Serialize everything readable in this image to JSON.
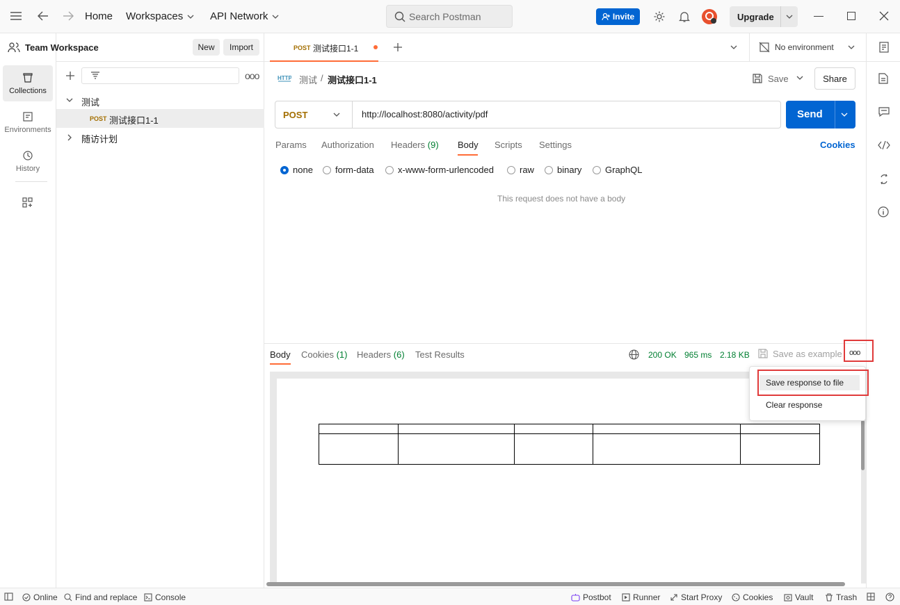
{
  "topbar": {
    "home": "Home",
    "workspaces": "Workspaces",
    "api_network": "API Network",
    "search_placeholder": "Search Postman",
    "invite": "Invite",
    "upgrade": "Upgrade"
  },
  "leftnav": {
    "collections": "Collections",
    "environments": "Environments",
    "history": "History"
  },
  "sidebar": {
    "workspace_name": "Team Workspace",
    "new_btn": "New",
    "import_btn": "Import",
    "tree": [
      {
        "label": "测试",
        "expanded": true
      },
      {
        "method": "POST",
        "label": "测试接口1-1",
        "selected": true
      },
      {
        "label": "随访计划",
        "expanded": false
      }
    ]
  },
  "tabs": {
    "open_tab_method": "POST",
    "open_tab_title": "测试接口1-1",
    "environment": "No environment"
  },
  "request": {
    "breadcrumb_parent": "测试",
    "breadcrumb_sep": "/",
    "breadcrumb_current": "测试接口1-1",
    "save": "Save",
    "share": "Share",
    "method": "POST",
    "url": "http://localhost:8080/activity/pdf",
    "send": "Send",
    "tabs": [
      "Params",
      "Authorization",
      "Headers",
      "Body",
      "Scripts",
      "Settings"
    ],
    "headers_count": "(9)",
    "active_tab": "Body",
    "cookies": "Cookies",
    "body_types": [
      "none",
      "form-data",
      "x-www-form-urlencoded",
      "raw",
      "binary",
      "GraphQL"
    ],
    "selected_body_type": "none",
    "empty_body_msg": "This request does not have a body"
  },
  "response": {
    "tabs": [
      "Body",
      "Cookies",
      "Headers",
      "Test Results"
    ],
    "cookies_count": "(1)",
    "headers_count": "(6)",
    "status": "200 OK",
    "time": "965 ms",
    "size": "2.18 KB",
    "save_example": "Save as example",
    "menu_items": [
      "Save response to file",
      "Clear response"
    ]
  },
  "statusbar": {
    "online": "Online",
    "find_replace": "Find and replace",
    "console": "Console",
    "postbot": "Postbot",
    "runner": "Runner",
    "start_proxy": "Start Proxy",
    "cookies": "Cookies",
    "vault": "Vault",
    "trash": "Trash"
  },
  "colors": {
    "accent_blue": "#0265d2",
    "method_post": "#a36e00",
    "status_green": "#007f31",
    "tab_active_underline": "#ff6c37",
    "highlight_red": "#e03a3a"
  }
}
